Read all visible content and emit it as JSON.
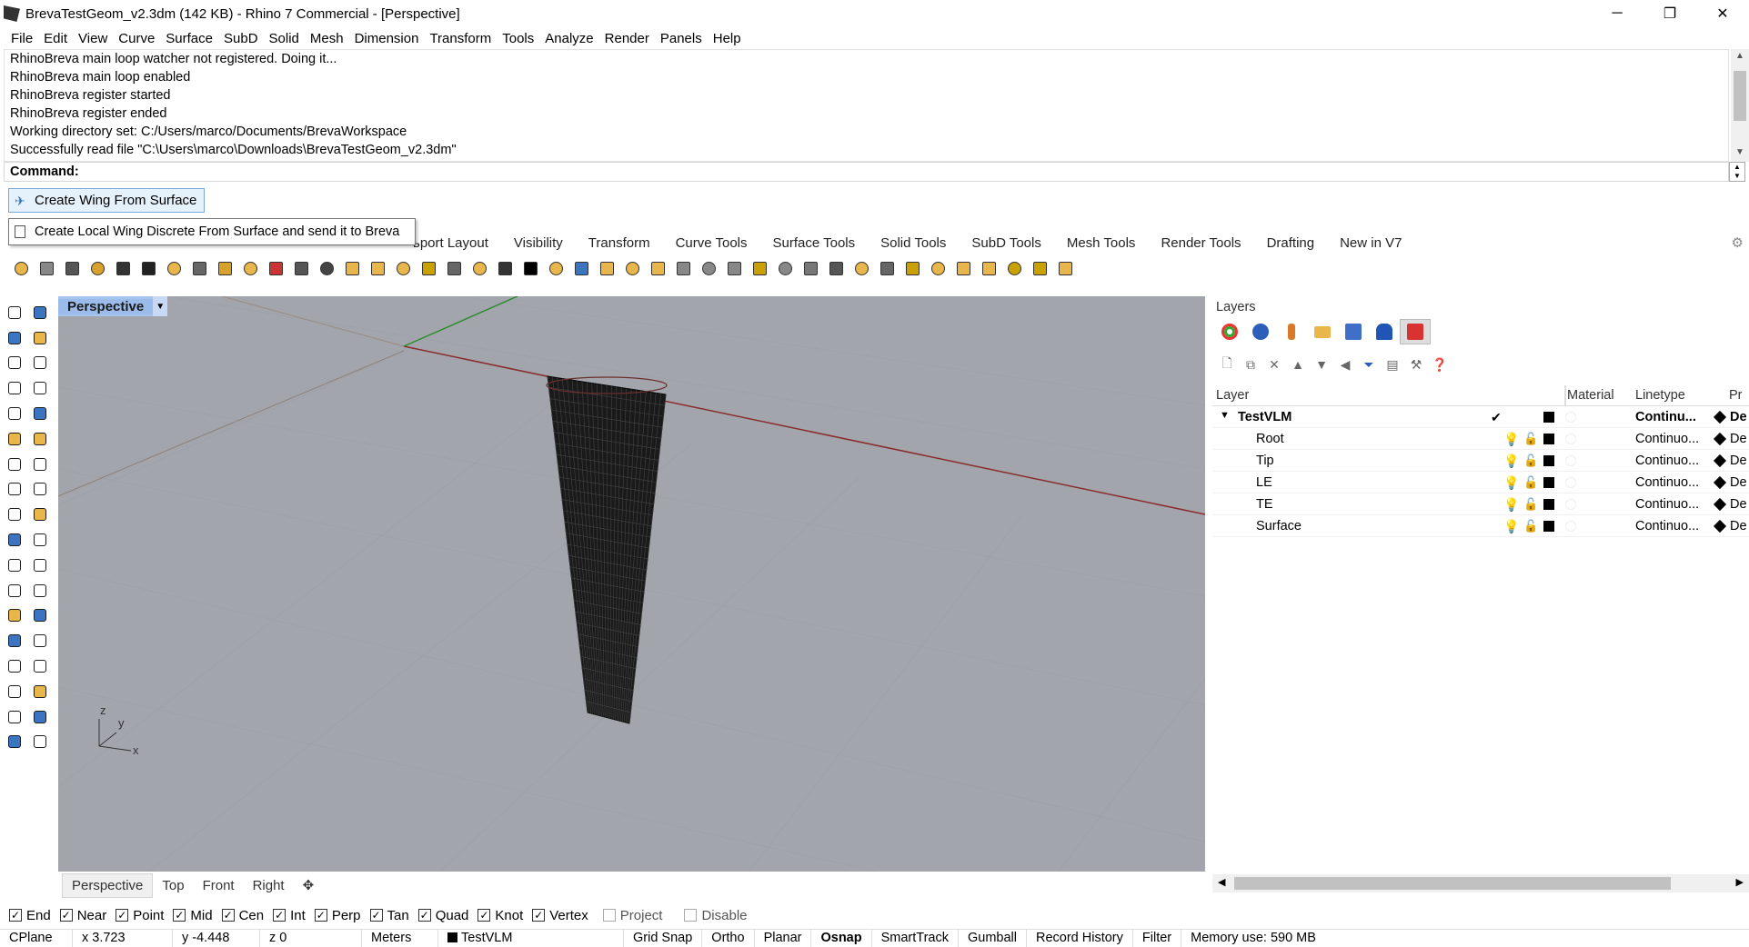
{
  "window": {
    "title": "BrevaTestGeom_v2.3dm (142 KB) - Rhino 7 Commercial - [Perspective]",
    "minimize": "─",
    "maximize": "❐",
    "close": "✕"
  },
  "menu": [
    "File",
    "Edit",
    "View",
    "Curve",
    "Surface",
    "SubD",
    "Solid",
    "Mesh",
    "Dimension",
    "Transform",
    "Tools",
    "Analyze",
    "Render",
    "Panels",
    "Help"
  ],
  "command_history": [
    "RhinoBreva main loop watcher not registered. Doing it...",
    "RhinoBreva main loop enabled",
    "RhinoBreva register started",
    "RhinoBreva register ended",
    "Working directory set: C:/Users/marco/Documents/BrevaWorkspace",
    "Successfully read file \"C:\\Users\\marco\\Downloads\\BrevaTestGeom_v2.3dm\""
  ],
  "command_prompt": "Command:",
  "macro_button": {
    "label": "Create Wing From Surface",
    "icon": "wing-icon"
  },
  "tooltip": "Create Local Wing Discrete From Surface and send it to Breva",
  "toolbar_tabs": [
    "ьport Layout",
    "Visibility",
    "Transform",
    "Curve Tools",
    "Surface Tools",
    "Solid Tools",
    "SubD Tools",
    "Mesh Tools",
    "Render Tools",
    "Drafting",
    "New in V7"
  ],
  "viewport": {
    "name": "Perspective",
    "axis_labels": {
      "z": "z",
      "y": "y",
      "x": "x"
    },
    "background": "#a2a6ac"
  },
  "viewport_tabs": [
    "Perspective",
    "Top",
    "Front",
    "Right"
  ],
  "layers_panel": {
    "title": "Layers",
    "columns": {
      "layer": "Layer",
      "material": "Material",
      "linetype": "Linetype",
      "print": "Pr"
    },
    "rows": [
      {
        "name": "TestVLM",
        "linetype": "Continu...",
        "print": "De",
        "parent": true
      },
      {
        "name": "Root",
        "linetype": "Continuo...",
        "print": "De"
      },
      {
        "name": "Tip",
        "linetype": "Continuo...",
        "print": "De"
      },
      {
        "name": "LE",
        "linetype": "Continuo...",
        "print": "De"
      },
      {
        "name": "TE",
        "linetype": "Continuo...",
        "print": "De"
      },
      {
        "name": "Surface",
        "linetype": "Continuo...",
        "print": "De"
      }
    ]
  },
  "osnaps": [
    {
      "label": "End",
      "checked": true
    },
    {
      "label": "Near",
      "checked": true
    },
    {
      "label": "Point",
      "checked": true
    },
    {
      "label": "Mid",
      "checked": true
    },
    {
      "label": "Cen",
      "checked": true
    },
    {
      "label": "Int",
      "checked": true
    },
    {
      "label": "Perp",
      "checked": true
    },
    {
      "label": "Tan",
      "checked": true
    },
    {
      "label": "Quad",
      "checked": true
    },
    {
      "label": "Knot",
      "checked": true
    },
    {
      "label": "Vertex",
      "checked": true
    },
    {
      "label": "Project",
      "checked": false
    },
    {
      "label": "Disable",
      "checked": false
    }
  ],
  "status": {
    "cplane": "CPlane",
    "x": "x 3.723",
    "y": "y -4.448",
    "z": "z 0",
    "units": "Meters",
    "layer": "TestVLM",
    "grid_snap": "Grid Snap",
    "ortho": "Ortho",
    "planar": "Planar",
    "osnap": "Osnap",
    "smarttrack": "SmartTrack",
    "gumball": "Gumball",
    "record_history": "Record History",
    "filter": "Filter",
    "memory": "Memory use: 590 MB"
  }
}
